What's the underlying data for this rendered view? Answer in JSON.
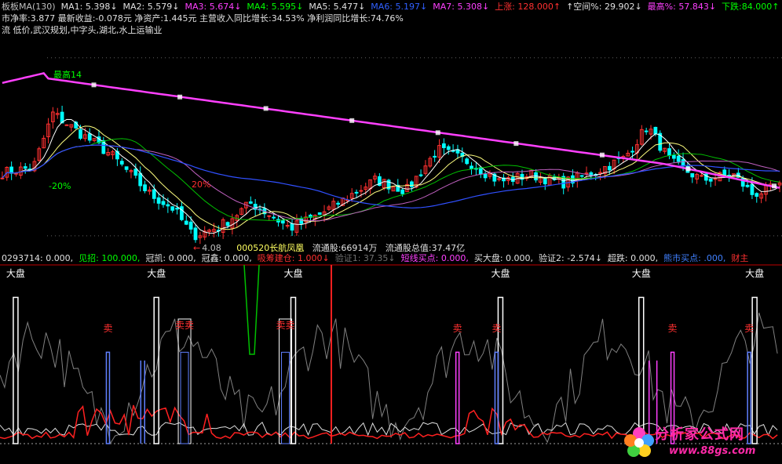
{
  "header": {
    "items": [
      {
        "text": "板板MA(130)",
        "color": "#c0c0c0"
      },
      {
        "text": "MA1: 5.398↓",
        "color": "#e0e0e0"
      },
      {
        "text": "MA2: 5.579↓",
        "color": "#e0e0e0"
      },
      {
        "text": "MA3: 5.674↓",
        "color": "#ff40ff"
      },
      {
        "text": "MA4: 5.595↓",
        "color": "#00ff00"
      },
      {
        "text": "MA5: 5.477↓",
        "color": "#e0e0e0"
      },
      {
        "text": "MA6: 5.197↓",
        "color": "#3060ff"
      },
      {
        "text": "MA7: 5.308↓",
        "color": "#ff40ff"
      },
      {
        "text": "上涨: 128.000↑",
        "color": "#ff3030"
      },
      {
        "text": "↑空间%: 29.902↓",
        "color": "#e0e0e0"
      },
      {
        "text": "最高%: 57.843↓",
        "color": "#ff40ff"
      },
      {
        "text": "下跌:84.000↑",
        "color": "#00ff00"
      }
    ]
  },
  "info_lines": {
    "line1": "市净率:3.877   最新收益:-0.078元    净资产:1.445元    主营收入同比增长:34.53%   净利润同比增长:74.76%",
    "line2": "流 低价,武汉规划,中字头,湖北,水上运输业"
  },
  "main_labels": {
    "low_price": "4.08",
    "low_arrow": "←",
    "pct_minus20": "-20%",
    "pct_20": "20%",
    "high_tag": "最高14",
    "stock": "000520长航凤凰",
    "float_shares": "流通股:66914万",
    "float_value": "流通股总值:37.47亿"
  },
  "indicator_header": {
    "items": [
      {
        "text": "0293714: 0.000,",
        "color": "#e0e0e0"
      },
      {
        "text": "见招: 100.000,",
        "color": "#00ff00"
      },
      {
        "text": "冠凯: 0.000,",
        "color": "#e0e0e0"
      },
      {
        "text": "冠鑫: 0.000,",
        "color": "#e0e0e0"
      },
      {
        "text": "吸筹建仓: 1.000↓",
        "color": "#ff3030"
      },
      {
        "text": "验证1: 37.35↓",
        "color": "#707070"
      },
      {
        "text": "短线买点: 0.000,",
        "color": "#ff40ff"
      },
      {
        "text": "买大盘: 0.000,",
        "color": "#e0e0e0"
      },
      {
        "text": "验证2: -2.574↓",
        "color": "#e0e0e0"
      },
      {
        "text": "超跌: 0.000,",
        "color": "#e0e0e0"
      },
      {
        "text": "熊市买点: .000,",
        "color": "#4080ff"
      },
      {
        "text": "财主",
        "color": "#ff3030"
      }
    ]
  },
  "signal_labels": {
    "dapan": "大盘",
    "mai": "卖"
  },
  "watermark": {
    "title": "分析家公式网",
    "url": "www.88gs.com"
  },
  "colors": {
    "bg": "#000000",
    "up": "#ff3030",
    "down": "#00ffff",
    "ma_long": "#ff40ff",
    "ma_blue": "#3050ff",
    "ma_green": "#00c000",
    "ma_white": "#ffffff",
    "signal_red": "#ff2020",
    "signal_magenta": "#ff40ff",
    "signal_blue": "#6080ff",
    "grey_line": "#808080"
  },
  "chart_data": {
    "type": "candlestick",
    "price_range": [
      3.9,
      14.6
    ],
    "y_levels": [
      4.08,
      14.0
    ],
    "low_value": 4.08,
    "signal_range": [
      0,
      100
    ],
    "dapan_positions": [
      0.02,
      0.2,
      0.375,
      0.64,
      0.82,
      0.965
    ],
    "mai_positions": [
      0.138,
      0.585,
      0.635,
      0.86,
      0.958
    ],
    "maimai_positions": [
      0.236,
      0.365
    ]
  }
}
